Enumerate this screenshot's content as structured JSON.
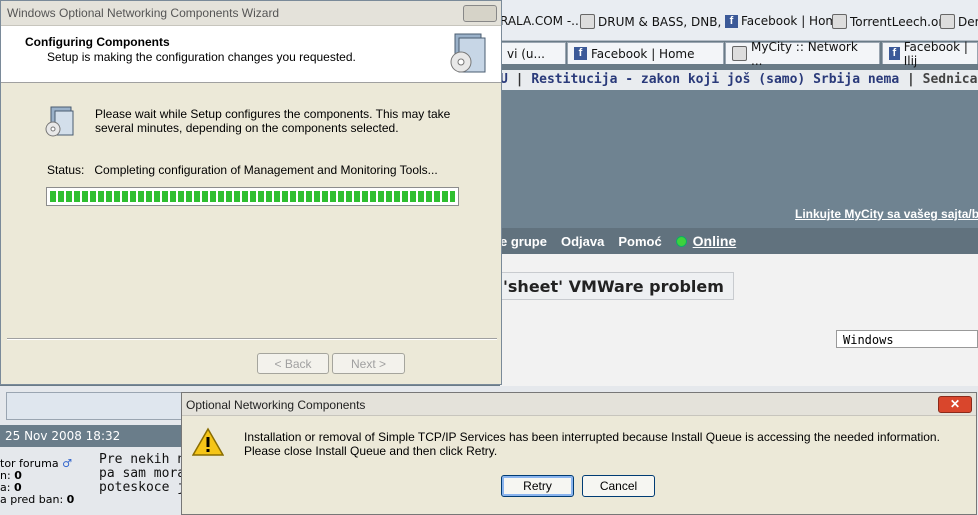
{
  "background": {
    "bookmarks": [
      "RALA.COM -...",
      "DRUM & BASS, DNB, ...",
      "Facebook | Home",
      "TorrentLeech.org",
      "Dem"
    ],
    "tabs": [
      "vi (u...",
      "Facebook | Home",
      "MyCity :: Network ...",
      "Facebook | Ilij"
    ],
    "ticker": {
      "pre": "U",
      "link": "Restitucija - zakon koji još (samo) Srbija nema",
      "sep": "|",
      "next": "Sednica Saveta za ko"
    },
    "linkuj": "Linkujte MyCity sa vašeg sajta/bl",
    "nav": [
      "e grupe",
      "Odjava",
      "Pomoć"
    ],
    "online": "Online",
    "topic_title": "'sheet' VMWare problem",
    "forum_select": "Windows",
    "post_date": "25 Nov 2008 18:32",
    "user_info": [
      {
        "label": "tor foruma",
        "value": "♂"
      },
      {
        "label": "n:",
        "value": "0"
      },
      {
        "label": "a:",
        "value": "0"
      },
      {
        "label": "a pred ban:",
        "value": "0"
      }
    ],
    "post_lines": [
      "Pre nekih ne",
      "pa sam mora",
      "poteskoce je"
    ]
  },
  "wizard": {
    "title": "Windows Optional Networking Components Wizard",
    "header_title": "Configuring Components",
    "header_subtitle": "Setup is making the configuration changes you requested.",
    "message": "Please wait while Setup configures the components. This may take several minutes, depending on the components selected.",
    "status_label": "Status:",
    "status_value": "Completing configuration of Management and Monitoring Tools...",
    "progress": 1.0,
    "back_label": "< Back",
    "next_label": "Next >"
  },
  "alert": {
    "title": "Optional Networking Components",
    "message": "Installation or removal of Simple TCP/IP Services has been interrupted because Install Queue is accessing the needed information.  Please close Install Queue and then click Retry.",
    "retry_label": "Retry",
    "cancel_label": "Cancel"
  }
}
